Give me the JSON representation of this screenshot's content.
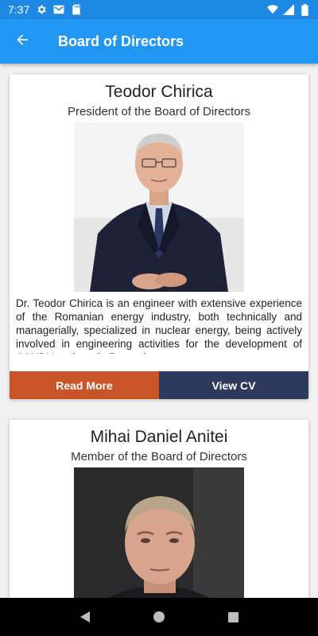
{
  "status_bar": {
    "time": "7:37",
    "icons": [
      "gear-icon",
      "gmail-icon",
      "sd-card-icon",
      "wifi-icon",
      "signal-icon",
      "battery-icon"
    ]
  },
  "app_bar": {
    "title": "Board of Directors",
    "back_icon": "arrow-back-icon"
  },
  "colors": {
    "status_bar": "#1e88e5",
    "app_bar": "#2196f3",
    "read_more_button": "#c85428",
    "view_cv_button": "#2e3a5c",
    "background": "#f1f1f1"
  },
  "members": [
    {
      "name": "Teodor Chirica",
      "role": "President of the Board of Directors",
      "description": "Dr. Teodor Chirica is an engineer with extensive experience of the Romanian energy industry, both technically and managerially, specialized in nuclear energy, being actively involved in engineering activities for the development of CANDU projects in Romania...",
      "read_more_label": "Read More",
      "view_cv_label": "View CV"
    },
    {
      "name": "Mihai Daniel Anitei",
      "role": "Member of the Board of Directors"
    }
  ],
  "nav_bar": {
    "icons": [
      "back-triangle-icon",
      "home-circle-icon",
      "recents-square-icon"
    ]
  }
}
